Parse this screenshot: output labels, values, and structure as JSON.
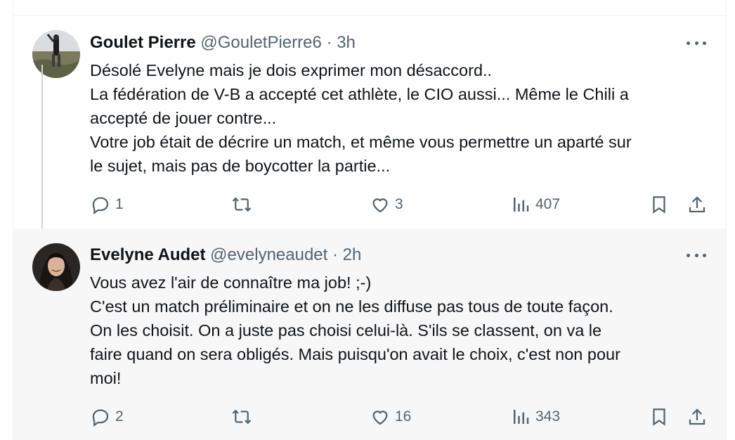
{
  "tweets": [
    {
      "name": "Goulet Pierre",
      "handle": "@GouletPierre6",
      "separator": "·",
      "time": "3h",
      "lines": [
        "Désolé Evelyne mais je dois exprimer mon désaccord..",
        "La fédération de V-B a accepté cet athlète, le CIO aussi... Même le Chili a",
        "accepté de jouer contre...",
        "Votre job était de décrire un match, et même vous permettre un aparté sur",
        "le sujet, mais pas de boycotter la partie..."
      ],
      "replies": "1",
      "retweets": "",
      "likes": "3",
      "views": "407"
    },
    {
      "name": "Evelyne Audet",
      "handle": "@evelyneaudet",
      "separator": "·",
      "time": "2h",
      "lines": [
        "Vous avez l'air de connaître ma job!  ;-)",
        "C'est un match préliminaire et on ne les diffuse pas tous de toute façon.",
        "On les choisit. On a juste pas choisi celui-là. S'ils se classent, on va le",
        "faire quand on sera obligés. Mais puisqu'on avait le choix, c'est non pour",
        "moi!"
      ],
      "replies": "2",
      "retweets": "",
      "likes": "16",
      "views": "343"
    }
  ],
  "icons": {
    "reply": "reply-icon",
    "retweet": "retweet-icon",
    "like": "heart-icon",
    "views": "views-icon",
    "bookmark": "bookmark-icon",
    "share": "share-icon",
    "more": "more-icon"
  },
  "colors": {
    "text": "#0f1419",
    "muted": "#536471",
    "thread": "#cfd9de",
    "highlight_bg": "#f7f7f7"
  }
}
